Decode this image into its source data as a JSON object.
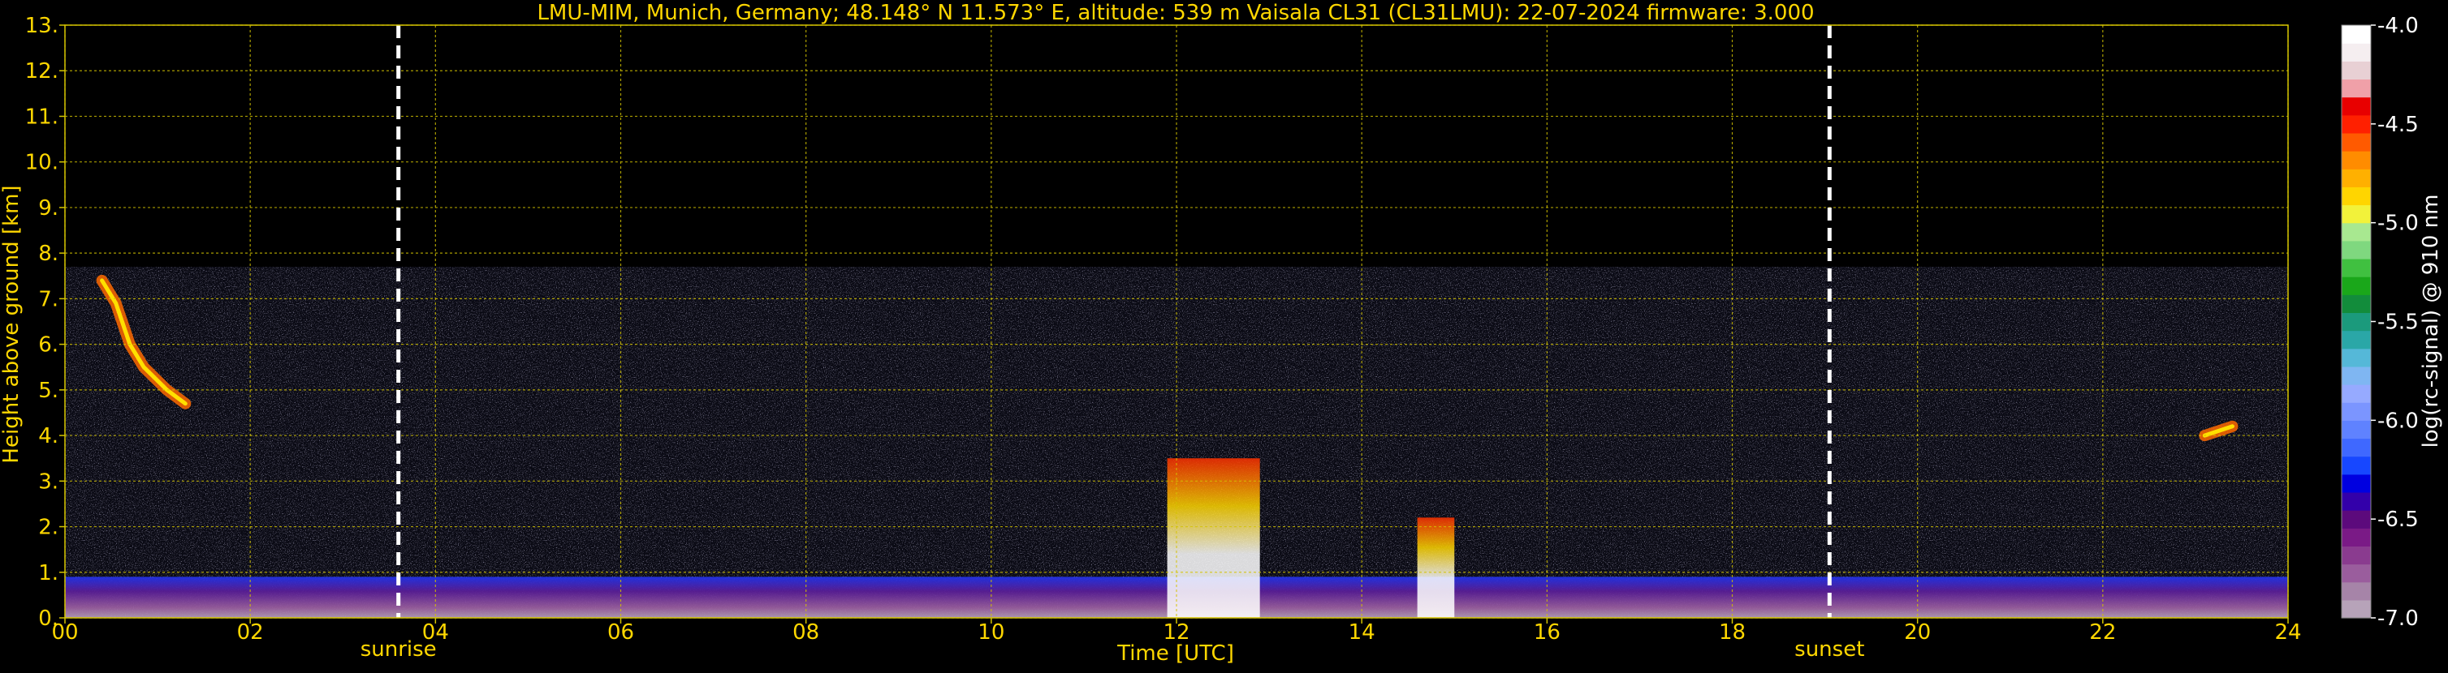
{
  "chart_data": {
    "type": "heatmap",
    "title": "LMU-MIM, Munich, Germany; 48.148° N 11.573° E, altitude: 539 m    Vaisala CL31 (CL31LMU): 22-07-2024    firmware: 3.000",
    "xlabel": "Time [UTC]",
    "ylabel": "Height above ground [km]",
    "xlim": [
      0,
      24
    ],
    "ylim": [
      0,
      13
    ],
    "x_ticks": [
      "00",
      "02",
      "04",
      "06",
      "08",
      "10",
      "12",
      "14",
      "16",
      "18",
      "20",
      "22",
      "24"
    ],
    "y_ticks": [
      "0.",
      "1.",
      "2.",
      "3.",
      "4.",
      "5.",
      "6.",
      "7.",
      "8.",
      "9.",
      "10.",
      "11.",
      "12.",
      "13."
    ],
    "grid": true,
    "signal_top_km": 7.7,
    "markers": [
      {
        "label": "sunrise",
        "time_utc": 3.6
      },
      {
        "label": "sunset",
        "time_utc": 19.05
      }
    ],
    "layers": [
      {
        "name": "surface-aerosol",
        "t_start": 0,
        "t_end": 24,
        "h_low": 0,
        "h_high": 0.9
      },
      {
        "name": "upper-cloud-morning",
        "points": [
          [
            0.4,
            7.4
          ],
          [
            0.55,
            6.9
          ],
          [
            0.7,
            6.0
          ],
          [
            0.85,
            5.5
          ],
          [
            1.1,
            5.0
          ],
          [
            1.3,
            4.7
          ]
        ]
      },
      {
        "name": "cloud-12utc",
        "t_start": 11.9,
        "t_end": 12.9,
        "h_low": 0,
        "h_high": 3.5
      },
      {
        "name": "cloud-14-15utc",
        "t_start": 14.6,
        "t_end": 15.0,
        "h_low": 0,
        "h_high": 2.2
      },
      {
        "name": "evening-layer",
        "points": [
          [
            23.1,
            4.0
          ],
          [
            23.4,
            4.2
          ]
        ]
      }
    ],
    "colorbar": {
      "label": "log(rc-signal) @ 910 nm",
      "range": [
        -7.0,
        -4.0
      ],
      "ticks": [
        "-4.0",
        "-4.5",
        "-5.0",
        "-5.5",
        "-6.0",
        "-6.5",
        "-7.0"
      ],
      "colors": [
        "#b7a3b9",
        "#a684a8",
        "#9a5d9d",
        "#8a3b8f",
        "#7a1a86",
        "#5c0a7c",
        "#3300aa",
        "#0000e0",
        "#1747ff",
        "#3f68ff",
        "#5f82ff",
        "#7b95ff",
        "#96aaff",
        "#7fb6f2",
        "#55b8d8",
        "#2aa7a7",
        "#1b9a7c",
        "#128c3b",
        "#1aa71a",
        "#40c040",
        "#7fd87f",
        "#a8e890",
        "#f2f23a",
        "#ffd500",
        "#ffb000",
        "#ff8c00",
        "#ff5a00",
        "#ff2000",
        "#e80000",
        "#f0a0a8",
        "#e8d0d4",
        "#f5eef0",
        "#ffffff"
      ]
    }
  }
}
